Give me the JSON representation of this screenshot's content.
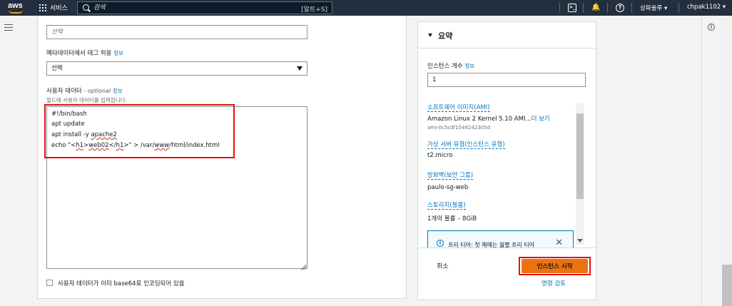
{
  "topbar": {
    "logo_text": "aws",
    "services_label": "서비스",
    "search_placeholder": "검색",
    "search_shortcut": "[알트+S]",
    "terminal_icon": "terminal-icon",
    "bell_icon": "bell-icon",
    "help_icon": "help-icon",
    "region": "상파울루 ▾",
    "user": "chpak1102 ▾"
  },
  "form": {
    "prev_field_placeholder": "선택",
    "tag_label": "메타데이터에서 태그 허용",
    "tag_info": "정보",
    "tag_select_value": "선택",
    "user_data_label": "사용자 데이터",
    "user_data_optional": "- optional",
    "user_data_info": "정보",
    "user_data_hint": "필드에 사용자 데이터를 입력합니다.",
    "code_lines": {
      "l1": "#!/bin/bash",
      "l2": "apt update",
      "l3a": "apt install -y ",
      "l3b": "apache2",
      "l4a": "echo \"<",
      "l4b": "h1",
      "l4c": ">",
      "l4d": "web02",
      "l4e": "</",
      "l4f": "h1",
      "l4g": ">\" > /var/",
      "l4h": "www",
      "l4i": "/html/index.html"
    },
    "base64_label": "사용자 데이터가 이미 base64로 인코딩되어 있음"
  },
  "summary": {
    "title": "요약",
    "instance_count_label": "인스턴스 개수",
    "instance_count_info": "정보",
    "instance_count_value": "1",
    "ami_label": "소프트웨어 이미지(AMI)",
    "ami_value": "Amazon Linux 2 Kernel 5.10 AMI...",
    "ami_more": "더 보기",
    "ami_id": "ami-0c5cdf1548242305d",
    "instance_type_label": "가상 서버 유형(인스턴스 유형)",
    "instance_type_value": "t2.micro",
    "firewall_label": "방화벽(보안 그룹)",
    "firewall_value": "paulo-sg-web",
    "storage_label": "스토리지(볼륨)",
    "storage_value": "1개의 볼륨 – 8GiB",
    "free_tier_text": "프리 티어: 첫 해에는 월별 프리 티어",
    "cancel_label": "취소",
    "launch_label": "인스턴스 시작",
    "review_label": "명령 검토"
  },
  "colors": {
    "topbar": "#232f3e",
    "link": "#0073bb",
    "launch_button": "#ec7211",
    "highlight_box": "#e8120c"
  }
}
